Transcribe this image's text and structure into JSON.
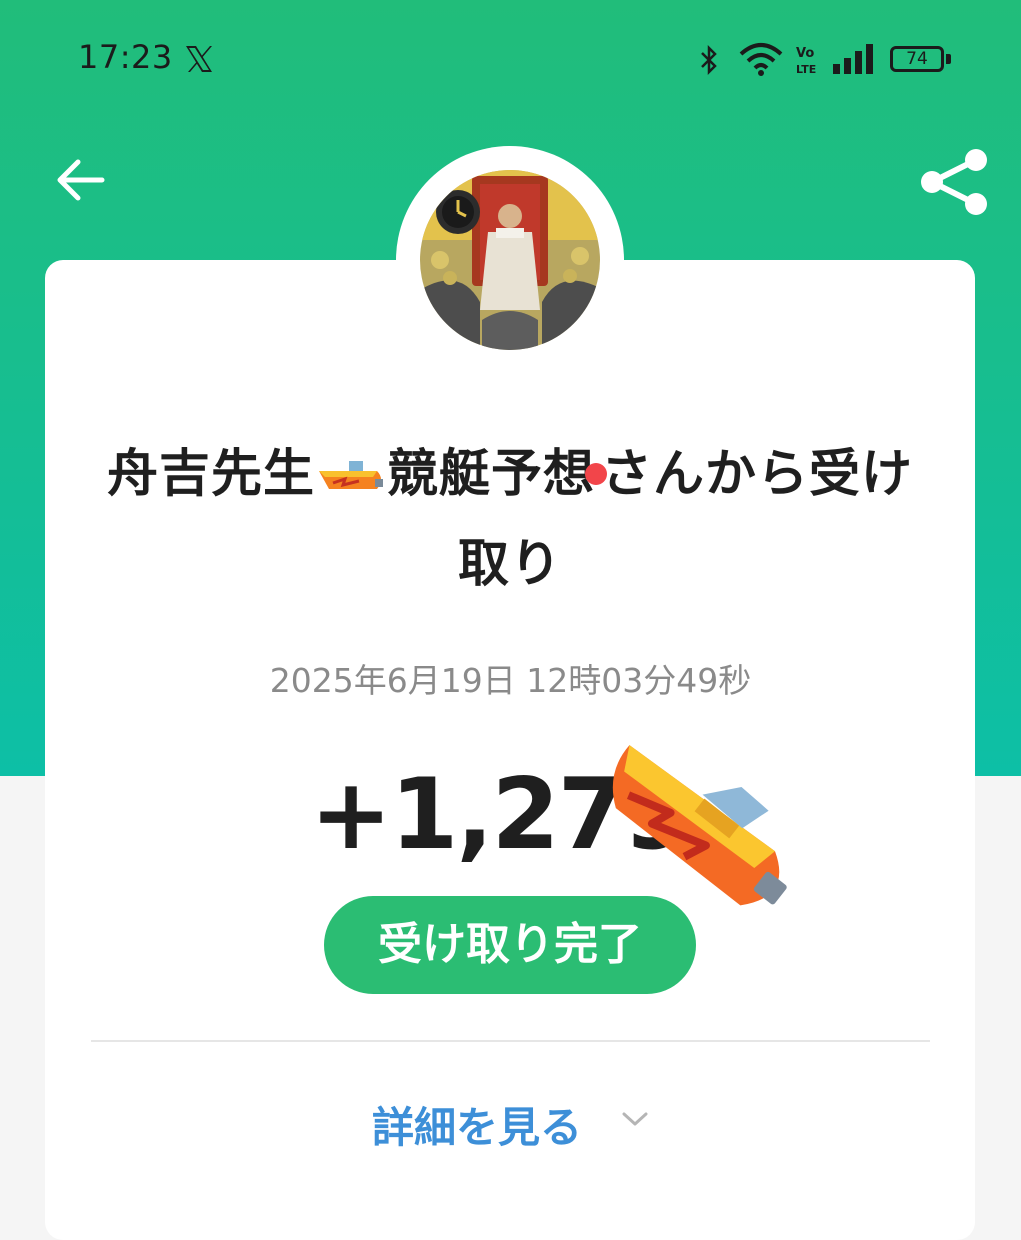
{
  "status_bar": {
    "time": "17:23",
    "app_icon": "x-logo-icon",
    "icons": [
      "bluetooth-icon",
      "wifi-icon",
      "volte-icon",
      "signal-icon"
    ],
    "battery_level": "74"
  },
  "header": {
    "back_icon": "arrow-left-icon",
    "share_icon": "share-icon"
  },
  "card": {
    "title_sender": "舟吉先生",
    "title_sender_suffix": "競艇予想",
    "title_tail": "さんから受け取り",
    "date": "2025年6月19日 12時03分49秒",
    "amount": "+1,279",
    "status_badge": "受け取り完了",
    "details_link": "詳細を見る"
  },
  "colors": {
    "header_gradient_top": "#21bd7a",
    "header_gradient_bottom": "#0dbfa6",
    "badge": "#2bbd73",
    "link": "#3d8fd8",
    "date_text": "#8a8a8a"
  }
}
